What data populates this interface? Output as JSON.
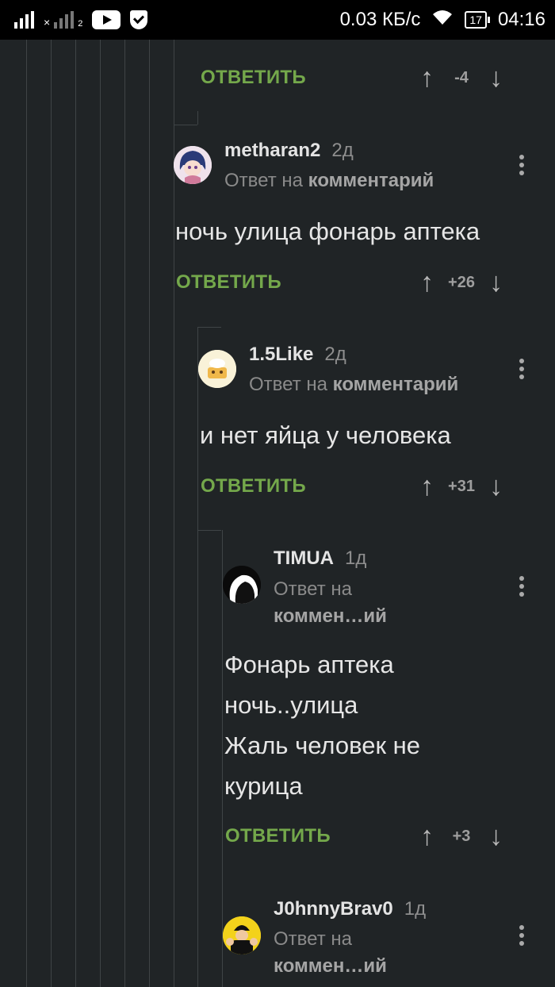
{
  "status_bar": {
    "speed": "0.03 КБ/с",
    "battery": "17",
    "time": "04:16",
    "sim2_index": "2"
  },
  "comments": [
    {
      "id": "top-partial",
      "reply_label": "ОТВЕТИТЬ",
      "score": "-4"
    },
    {
      "id": "metharan2",
      "username": "metharan2",
      "age": "2д",
      "reply_to_prefix": "Ответ на",
      "reply_to_link": "комментарий",
      "lines": [
        "ночь улица фонарь аптека"
      ],
      "reply_label": "ОТВЕТИТЬ",
      "score": "+26"
    },
    {
      "id": "1.5like",
      "username": "1.5Like",
      "age": "2д",
      "reply_to_prefix": "Ответ на",
      "reply_to_link": "комментарий",
      "lines": [
        "и нет яйца у человека"
      ],
      "reply_label": "ОТВЕТИТЬ",
      "score": "+31"
    },
    {
      "id": "timua",
      "username": "TIMUA",
      "age": "1д",
      "reply_to_prefix": "Ответ на",
      "reply_to_link": "коммен…ий",
      "lines": [
        "Фонарь аптека",
        "ночь..улица",
        "Жаль человек не",
        "курица"
      ],
      "reply_label": "ОТВЕТИТЬ",
      "score": "+3"
    },
    {
      "id": "j0hnnybrav0",
      "username": "J0hnnyBrav0",
      "age": "1д",
      "reply_to_prefix": "Ответ на",
      "reply_to_link": "коммен…ий"
    }
  ],
  "colors": {
    "background": "#202426",
    "reply_accent": "#74a84b",
    "thread_line": "#3f4446"
  }
}
